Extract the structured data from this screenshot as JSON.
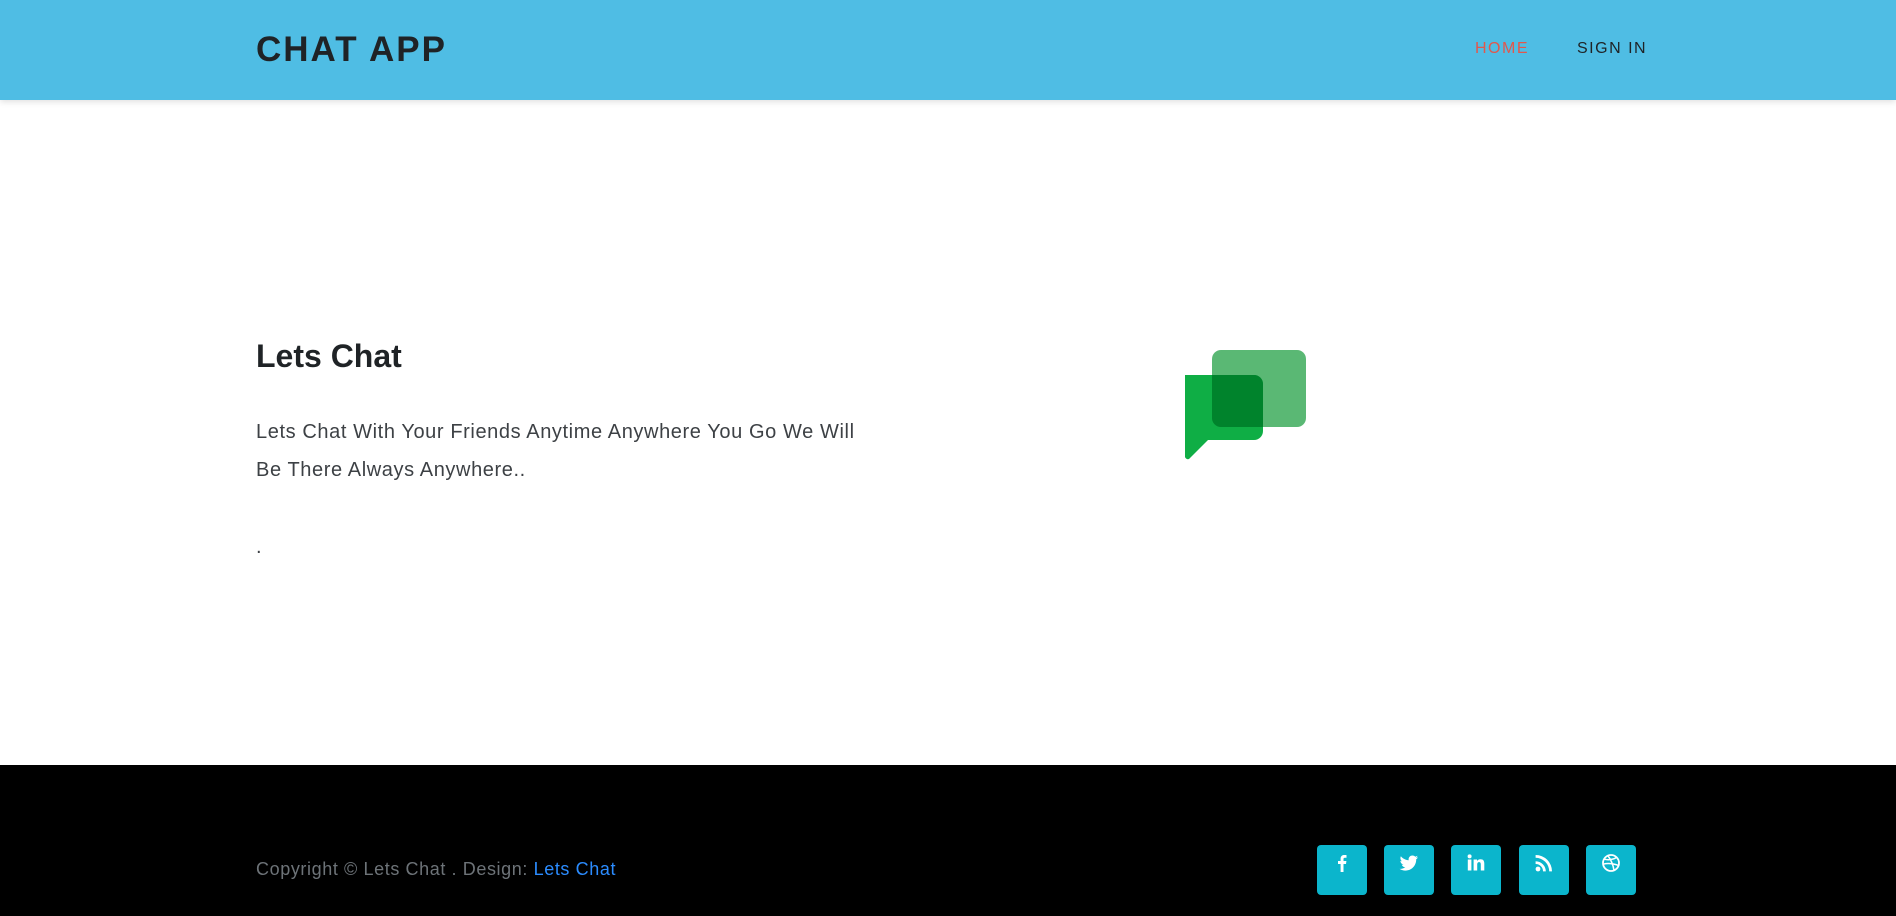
{
  "header": {
    "brand": "CHAT APP",
    "nav": [
      {
        "label": "HOME",
        "color": "#e2574c"
      },
      {
        "label": "SIGN IN",
        "color": "#1f2326"
      }
    ],
    "background": "#4fbde4"
  },
  "hero": {
    "title": "Lets Chat",
    "text": "Lets Chat With Your Friends Anytime Anywhere You Go We Will Be There Always Anywhere..",
    "dot": ".",
    "logo": "chat-bubbles-icon"
  },
  "footer": {
    "copyright": "Copyright © Lets Chat . Design: ",
    "design_link": "Lets Chat",
    "social": [
      "facebook-icon",
      "twitter-icon",
      "linkedin-icon",
      "rss-icon",
      "dribbble-icon"
    ],
    "social_color": "#0bb5cc"
  }
}
